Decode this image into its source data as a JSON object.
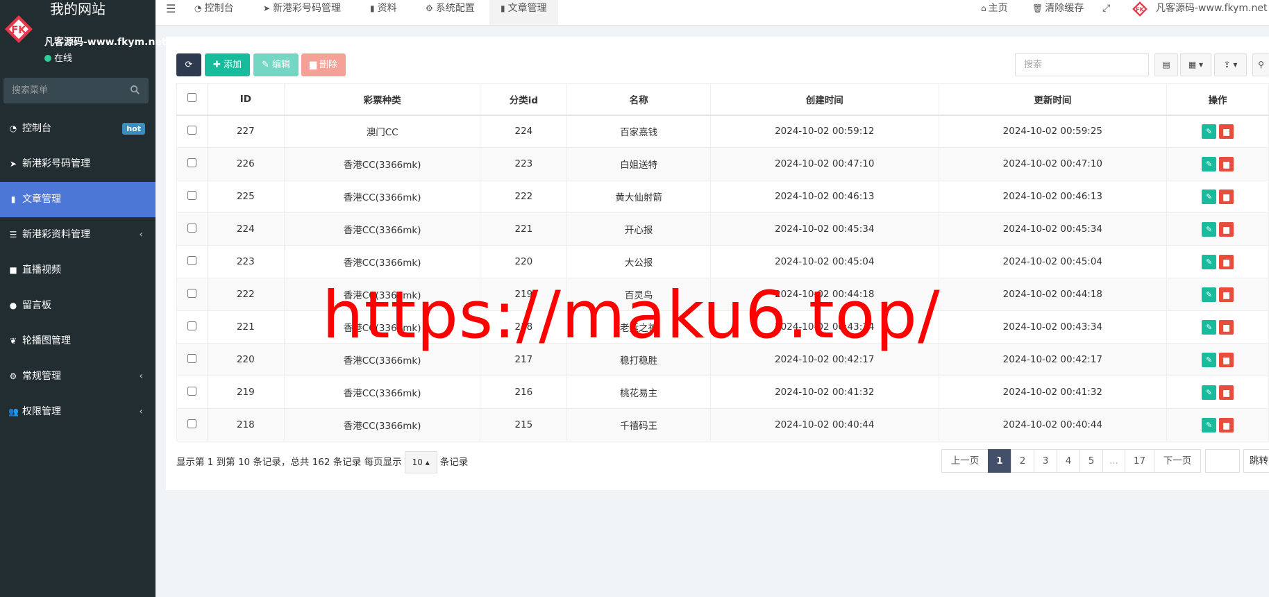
{
  "sidebar": {
    "site_title": "我的网站",
    "user_name": "凡客源码-www.fkym.net",
    "status": "在线",
    "search_placeholder": "搜索菜单",
    "items": [
      {
        "label": "控制台",
        "icon": "dashboard-icon",
        "badge": "hot"
      },
      {
        "label": "新港彩号码管理",
        "icon": "location-arrow-icon"
      },
      {
        "label": "文章管理",
        "icon": "bookmark-icon",
        "active": true
      },
      {
        "label": "新港彩资料管理",
        "icon": "list-icon",
        "chevron": "‹"
      },
      {
        "label": "直播视频",
        "icon": "video-icon"
      },
      {
        "label": "留言板",
        "icon": "comment-icon"
      },
      {
        "label": "轮播图管理",
        "icon": "leaf-icon"
      },
      {
        "label": "常规管理",
        "icon": "cogs-icon",
        "chevron": "‹"
      },
      {
        "label": "权限管理",
        "icon": "users-icon",
        "chevron": "‹"
      }
    ]
  },
  "topnav": {
    "tabs": [
      {
        "label": "控制台",
        "icon": "dashboard-icon"
      },
      {
        "label": "新港彩号码管理",
        "icon": "location-arrow-icon"
      },
      {
        "label": "资料",
        "icon": "bookmark-icon"
      },
      {
        "label": "系统配置",
        "icon": "gear-icon"
      },
      {
        "label": "文章管理",
        "icon": "bookmark-icon",
        "active": true
      }
    ],
    "home": "主页",
    "clear_cache": "清除缓存",
    "user": "凡客源码-www.fkym.net"
  },
  "toolbar": {
    "add": "添加",
    "edit": "编辑",
    "delete": "删除",
    "search_placeholder": "搜索"
  },
  "table": {
    "headers": [
      "ID",
      "彩票种类",
      "分类id",
      "名称",
      "创建时间",
      "更新时间",
      "操作"
    ],
    "rows": [
      {
        "id": "227",
        "category": "澳门CC",
        "cat_id": "224",
        "name": "百家熹钱",
        "created": "2024-10-02 00:59:12",
        "updated": "2024-10-02 00:59:25",
        "cat_color": "red"
      },
      {
        "id": "226",
        "category": "香港CC(3366mk)",
        "cat_id": "223",
        "name": "白姐送特",
        "created": "2024-10-02 00:47:10",
        "updated": "2024-10-02 00:47:10",
        "cat_color": "blue"
      },
      {
        "id": "225",
        "category": "香港CC(3366mk)",
        "cat_id": "222",
        "name": "黄大仙射箭",
        "created": "2024-10-02 00:46:13",
        "updated": "2024-10-02 00:46:13",
        "cat_color": "blue"
      },
      {
        "id": "224",
        "category": "香港CC(3366mk)",
        "cat_id": "221",
        "name": "开心报",
        "created": "2024-10-02 00:45:34",
        "updated": "2024-10-02 00:45:34",
        "cat_color": "blue"
      },
      {
        "id": "223",
        "category": "香港CC(3366mk)",
        "cat_id": "220",
        "name": "大公报",
        "created": "2024-10-02 00:45:04",
        "updated": "2024-10-02 00:45:04",
        "cat_color": "blue"
      },
      {
        "id": "222",
        "category": "香港CC(3366mk)",
        "cat_id": "219",
        "name": "百灵鸟",
        "created": "2024-10-02 00:44:18",
        "updated": "2024-10-02 00:44:18",
        "cat_color": "blue"
      },
      {
        "id": "221",
        "category": "香港CC(3366mk)",
        "cat_id": "218",
        "name": "老运之神",
        "created": "2024-10-02 00:43:34",
        "updated": "2024-10-02 00:43:34",
        "cat_color": "blue"
      },
      {
        "id": "220",
        "category": "香港CC(3366mk)",
        "cat_id": "217",
        "name": "稳打稳胜",
        "created": "2024-10-02 00:42:17",
        "updated": "2024-10-02 00:42:17",
        "cat_color": "blue"
      },
      {
        "id": "219",
        "category": "香港CC(3366mk)",
        "cat_id": "216",
        "name": "桃花易主",
        "created": "2024-10-02 00:41:32",
        "updated": "2024-10-02 00:41:32",
        "cat_color": "blue"
      },
      {
        "id": "218",
        "category": "香港CC(3366mk)",
        "cat_id": "215",
        "name": "千禧码王",
        "created": "2024-10-02 00:40:44",
        "updated": "2024-10-02 00:40:44",
        "cat_color": "blue"
      }
    ]
  },
  "footer": {
    "info_prefix": "显示第 1 到第 10 条记录，总共 162 条记录 每页显示",
    "page_size": "10",
    "info_suffix": "条记录",
    "prev": "上一页",
    "pages": [
      "1",
      "2",
      "3",
      "4",
      "5",
      "...",
      "17"
    ],
    "current_page": "1",
    "next": "下一页",
    "jump": "跳转"
  },
  "watermark": "https://maku6.top/",
  "colors": {
    "sidebar_bg": "#222d32",
    "active_menu": "#4c77d6",
    "success": "#18bc9c",
    "danger": "#e74c3c",
    "link": "#3c8dbc"
  }
}
